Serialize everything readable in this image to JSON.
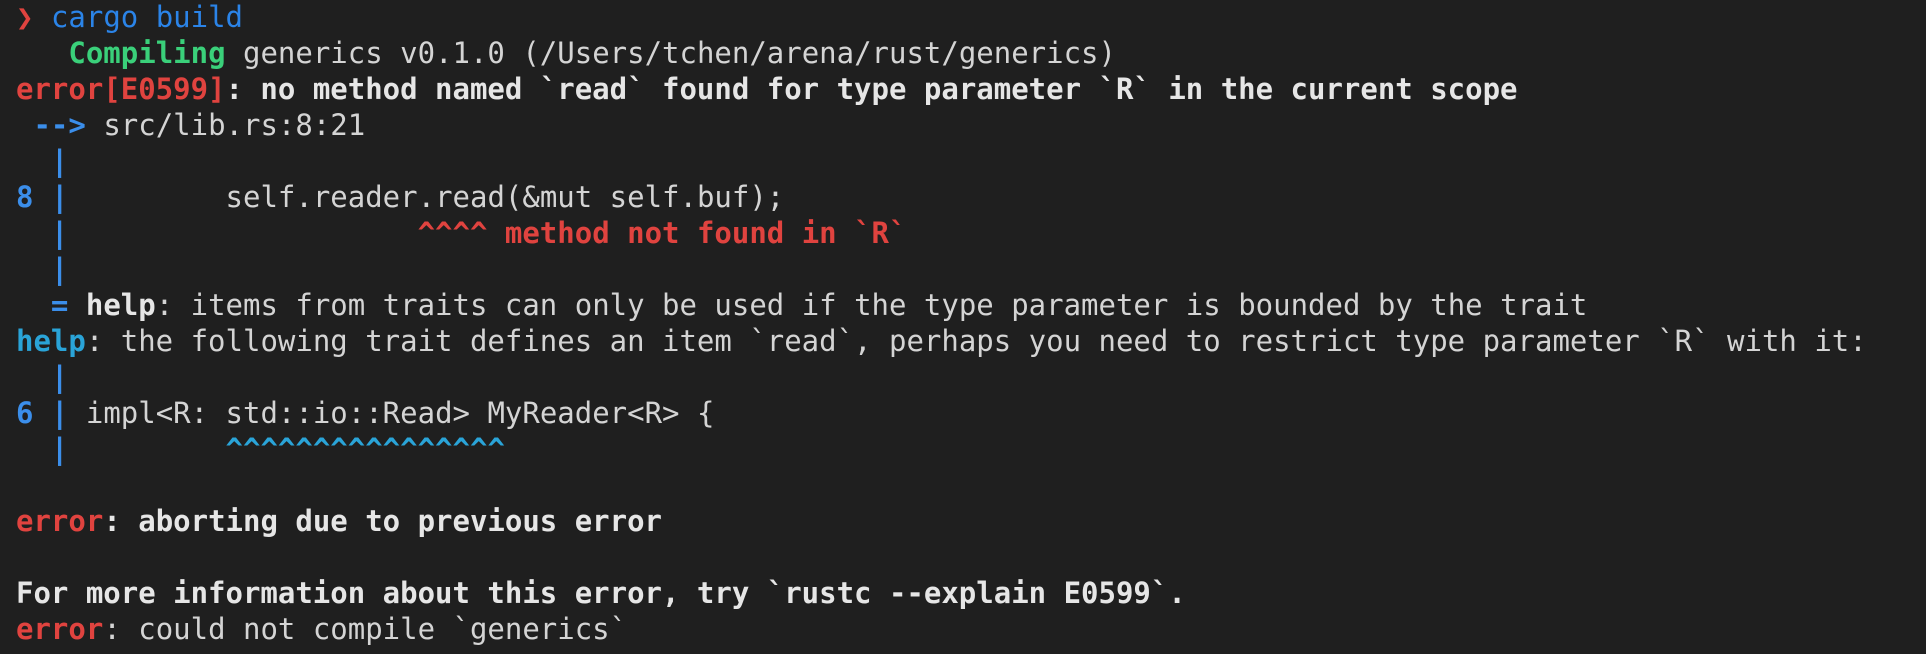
{
  "prompt": {
    "arrow": "❯",
    "command": "cargo",
    "argument": "build"
  },
  "compiling": {
    "status": "Compiling",
    "text": "generics v0.1.0 (/Users/tchen/arena/rust/generics)"
  },
  "error1": {
    "code": "error[E0599]",
    "message": ": no method named `read` found for type parameter `R` in the current scope",
    "location_arrow": "-->",
    "location": "src/lib.rs:8:21",
    "line_number": "8",
    "code_line": "        self.reader.read(&mut self.buf);",
    "pointer_pad": "                   ",
    "pointer": "^^^^ method not found in `R`",
    "note_prefix": "=",
    "note_label": "help",
    "note_text": ": items from traits can only be used if the type parameter is bounded by the trait"
  },
  "help": {
    "label": "help",
    "text": ": the following trait defines an item `read`, perhaps you need to restrict type parameter `R` with it:",
    "line_number": "6",
    "code_line": "impl<R: std::io::Read> MyReader<R> {",
    "pointer_pad": "        ",
    "pointer": "^^^^^^^^^^^^^^^^"
  },
  "gutter": "|",
  "abort": {
    "label": "error",
    "text": ": aborting due to previous error"
  },
  "more_info": "For more information about this error, try `rustc --explain E0599`.",
  "final": {
    "label": "error",
    "text": ": could not compile `generics`"
  },
  "colors": {
    "background": "#1f1f1f",
    "error_red": "#e0433f",
    "gutter_blue": "#3b8eea",
    "help_cyan": "#2aa4d8",
    "compiling_green": "#3ad07a"
  }
}
